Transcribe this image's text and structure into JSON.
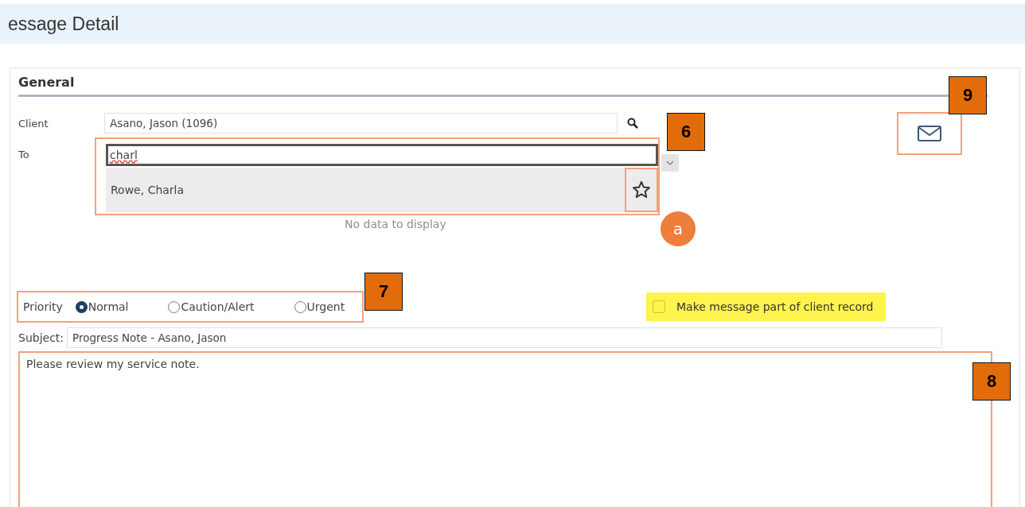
{
  "window": {
    "title": "essage Detail"
  },
  "section": {
    "title": "General"
  },
  "client": {
    "label": "Client",
    "value": "Asano, Jason (1096)"
  },
  "to": {
    "label": "To",
    "value": "charl",
    "suggestions": [
      {
        "name": "Rowe, Charla",
        "favorite": false
      }
    ],
    "empty_text": "No data to display"
  },
  "priority": {
    "label": "Priority",
    "options": [
      {
        "label": "Normal",
        "selected": true
      },
      {
        "label": "Caution/Alert",
        "selected": false
      },
      {
        "label": "Urgent",
        "selected": false
      }
    ]
  },
  "client_record": {
    "label": "Make message part of client record",
    "checked": false,
    "highlighted": true
  },
  "subject": {
    "label": "Subject:",
    "value": "Progress Note - Asano, Jason"
  },
  "body": {
    "value": "Please review my service note."
  },
  "callouts": [
    {
      "label": "6",
      "kind": "square"
    },
    {
      "label": "a",
      "kind": "circle"
    },
    {
      "label": "7",
      "kind": "square"
    },
    {
      "label": "8",
      "kind": "square"
    },
    {
      "label": "9",
      "kind": "square"
    }
  ]
}
